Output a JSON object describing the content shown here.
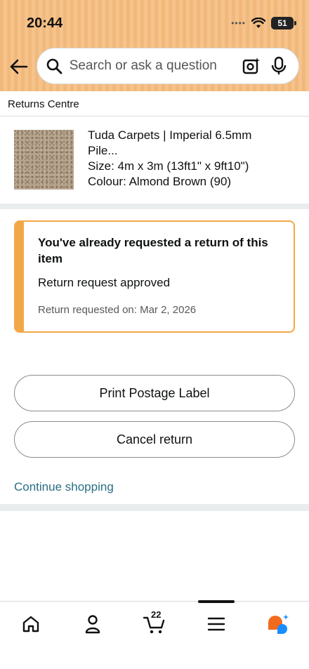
{
  "status_bar": {
    "time": "20:44",
    "signal": "••••",
    "battery": "51"
  },
  "search": {
    "placeholder": "Search or ask a question"
  },
  "breadcrumb": {
    "label": "Returns Centre"
  },
  "product": {
    "title_line1": "Tuda Carpets | Imperial 6.5mm",
    "title_line2": "Pile...",
    "size": "Size: 4m x 3m (13ft1\" x 9ft10\")",
    "colour": "Colour: Almond Brown (90)"
  },
  "alert": {
    "title": "You've already requested a return of this item",
    "status": "Return request approved",
    "requested_on": "Return requested on: Mar 2, 2026",
    "accent_color": "#f3a847"
  },
  "actions": {
    "print_label": "Print Postage Label",
    "cancel_return": "Cancel return",
    "continue_shopping": "Continue shopping"
  },
  "bottom_nav": {
    "items": [
      "home-icon",
      "account-icon",
      "cart-icon",
      "menu-icon",
      "rufus-icon"
    ],
    "cart_count": "22"
  },
  "colors": {
    "header_bg": "#f2b87a",
    "link": "#2a6f86",
    "alert_border": "#f3a847"
  }
}
